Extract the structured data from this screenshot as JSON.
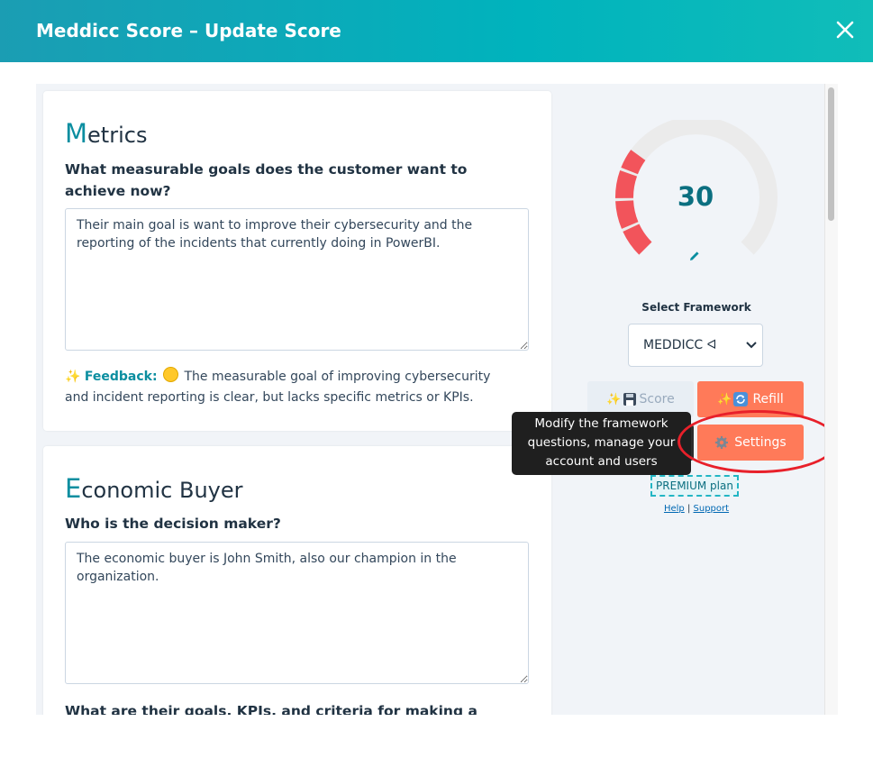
{
  "header": {
    "title": "Meddicc Score – Update Score",
    "close_icon": "close-icon"
  },
  "sections": [
    {
      "title_first": "M",
      "title_rest": "etrics",
      "question": "What measurable goals does the customer want to achieve now?",
      "answer": "Their main goal is want to improve their cybersecurity and the reporting of the incidents that currently doing in PowerBI.",
      "feedback_label": "Feedback:",
      "feedback_text": "The measurable goal of improving cybersecurity and incident reporting is clear, but lacks specific metrics or KPIs."
    },
    {
      "title_first": "E",
      "title_rest": "conomic Buyer",
      "question": "Who is the decision maker?",
      "answer": "The economic buyer is John Smith, also our champion in the organization.",
      "question2": "What are their goals, KPIs, and criteria for making a"
    }
  ],
  "score": {
    "value": "30",
    "progress": 0.3,
    "low_color": "#f2545b",
    "track_color": "#ebebeb"
  },
  "framework": {
    "label": "Select Framework",
    "selected": "MEDDICC ᐊ"
  },
  "buttons": {
    "score": "Score",
    "refill": "Refill",
    "settings": "Settings"
  },
  "tooltip": "Modify the framework questions, manage your account and users",
  "plan": "PREMIUM plan",
  "links": {
    "help": "Help",
    "separator": "|",
    "support": "Support"
  },
  "colors": {
    "brand": "#0b8ea0",
    "accent": "#ff7a59",
    "highlight": "#e8202a"
  }
}
